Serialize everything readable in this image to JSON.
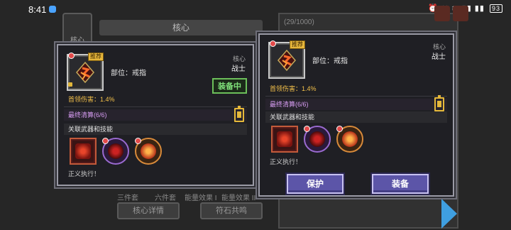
{
  "status": {
    "time": "8:41",
    "battery": "93",
    "icons": "⏰ ✕ ≋ ▮▮ ▮▮"
  },
  "background": {
    "left_tab": "核心",
    "title": "核心",
    "counter": "(29/1000)",
    "bottom_texts": [
      "三件套",
      "六件套",
      "能量效果 I",
      "能量效果 II"
    ],
    "btn_core_detail": "核心详情",
    "btn_rune": "符石共鸣"
  },
  "card_left": {
    "tag": "推荐",
    "slot": "部位：戒指",
    "core": "核心",
    "class": "战士",
    "equipped": "装备中",
    "stat": "首领伤害：1.4%",
    "set_text": "最终清算(6/6)",
    "related": "关联武器和技能",
    "skill_name": "正义执行！"
  },
  "card_right": {
    "tag": "推荐",
    "slot": "部位：戒指",
    "core": "核心",
    "class": "战士",
    "stat": "首领伤害：1.4%",
    "set_text": "最终清算(6/6)",
    "related": "关联武器和技能",
    "skill_name": "正义执行！",
    "btn_protect": "保护",
    "btn_equip": "装备"
  },
  "colors": {
    "accent_purple": "#5c55a8",
    "stat_gold": "#f3c04a",
    "equipped_green": "#7fe07a",
    "set_purple": "#d79cf2"
  }
}
